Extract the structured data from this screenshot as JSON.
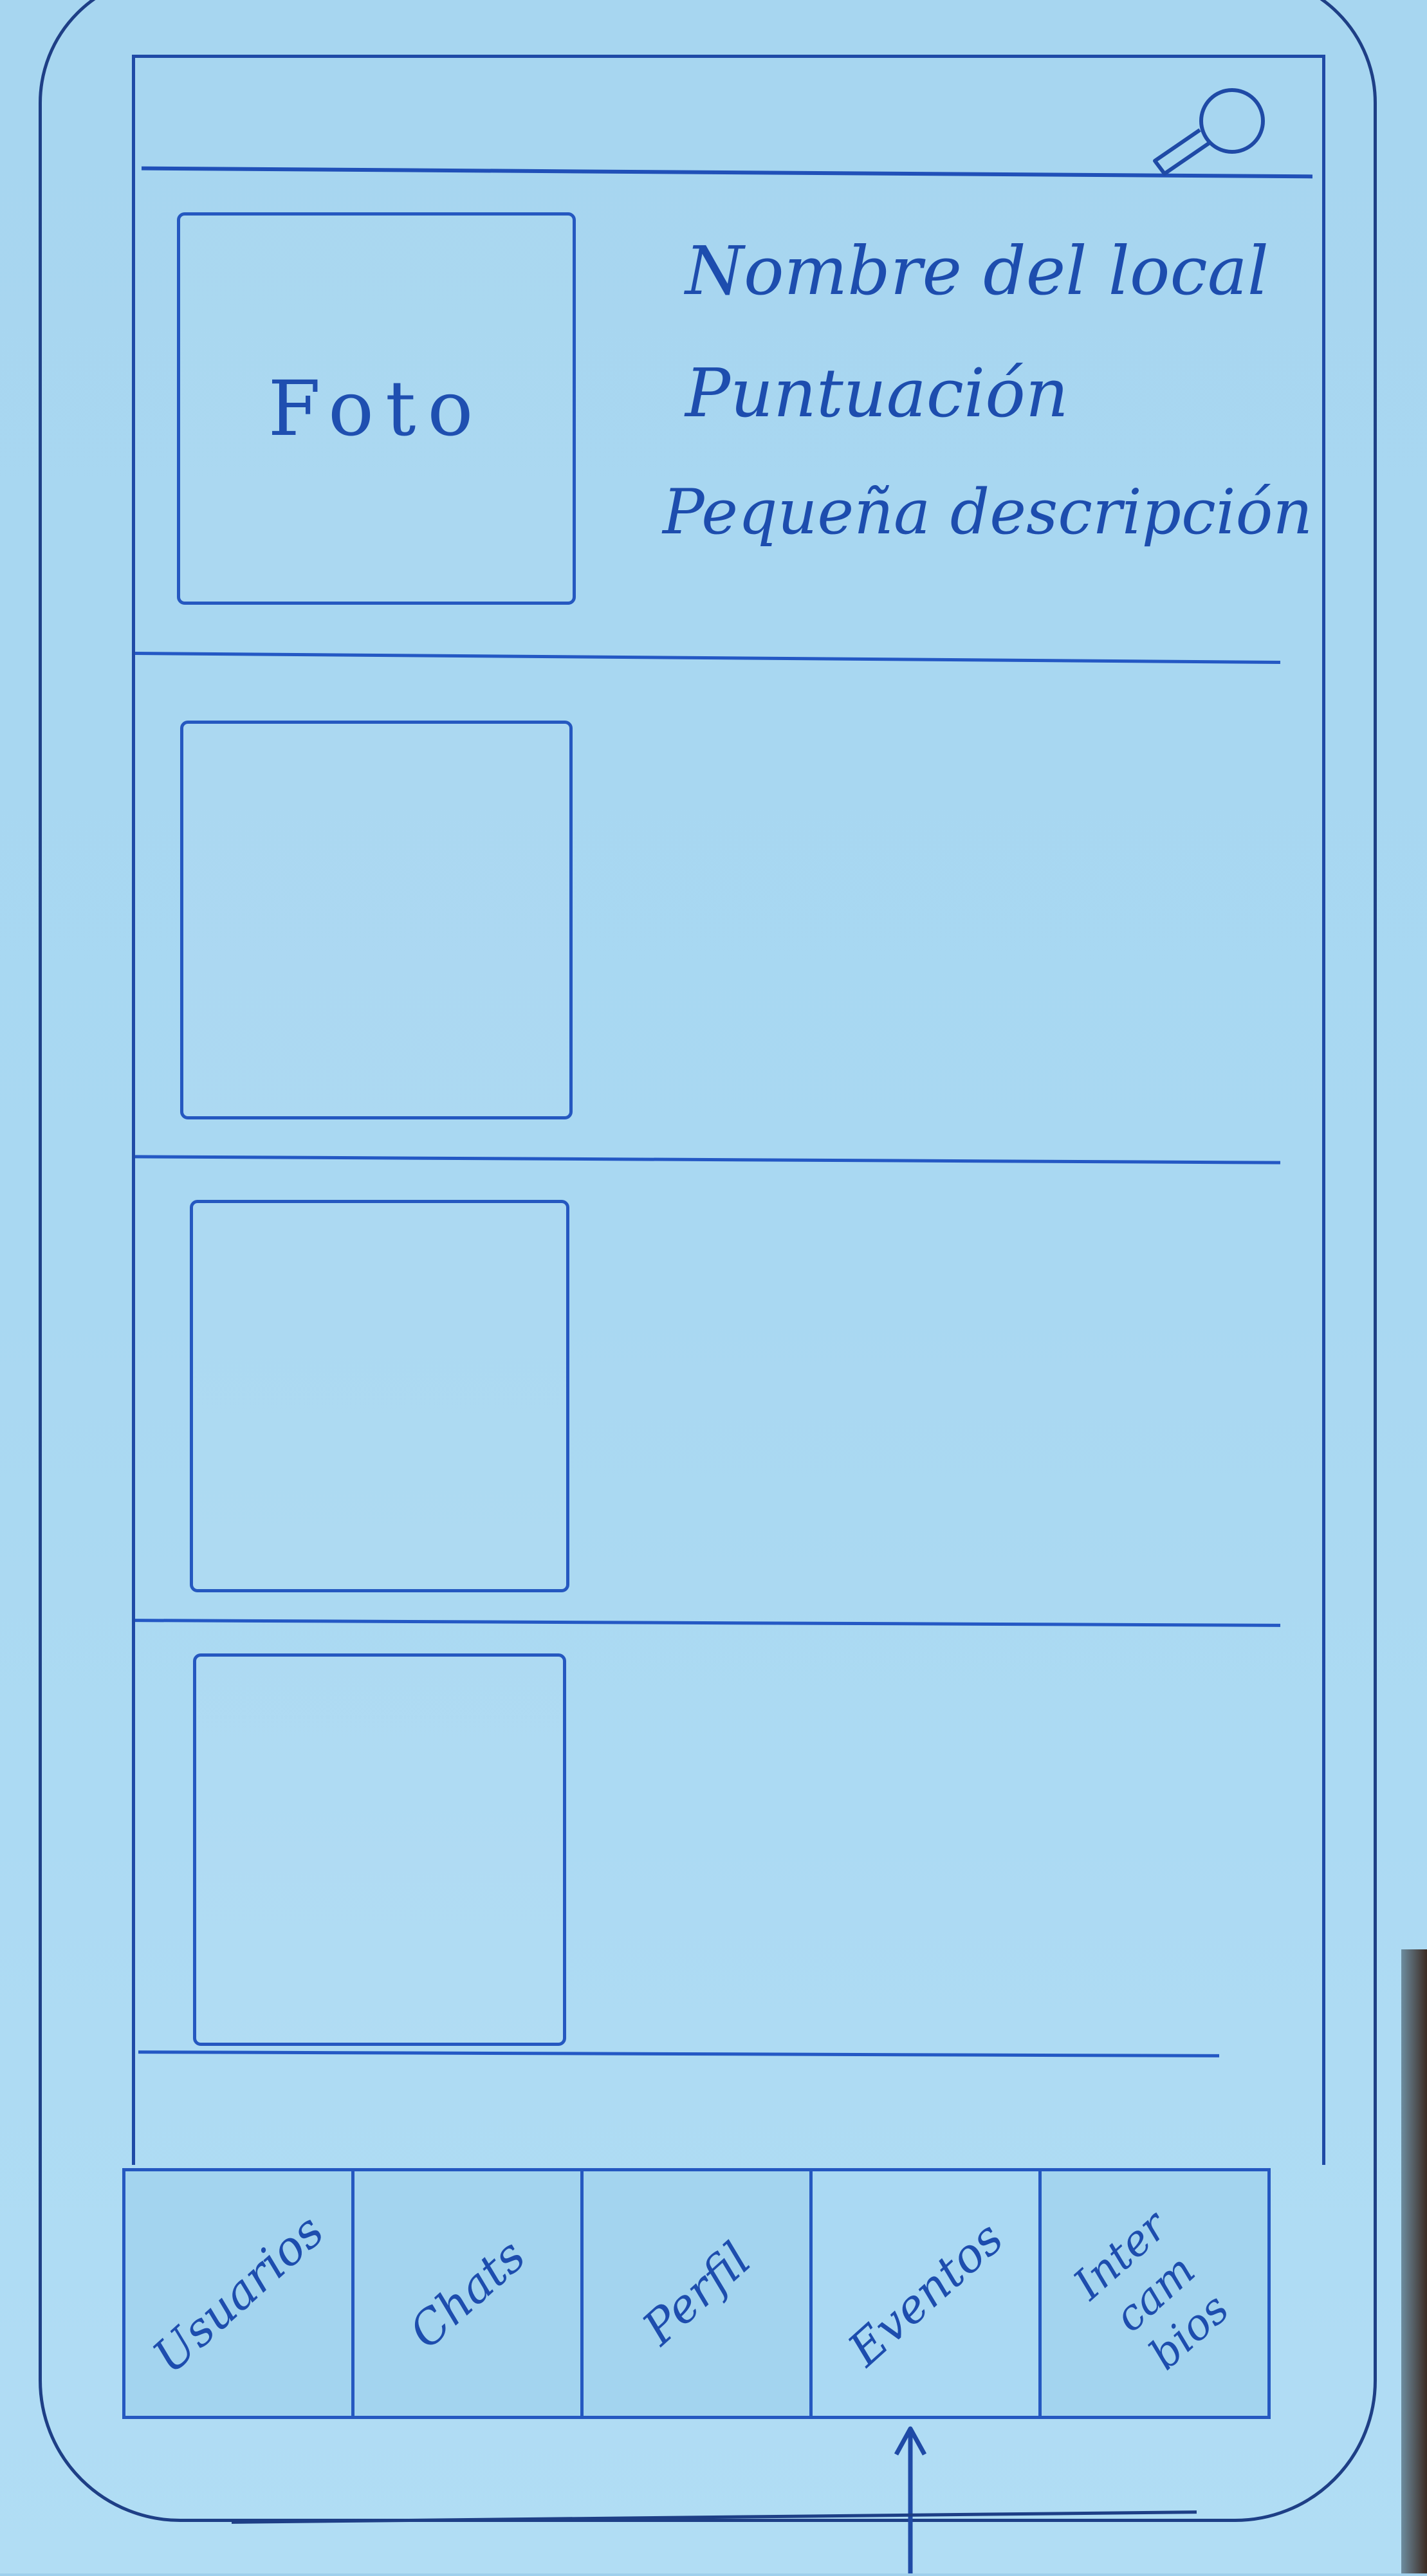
{
  "app": {
    "screen": "lista-locales",
    "colors": {
      "ink": "#1f4fb0",
      "paper": "#a7d6f0"
    }
  },
  "header": {
    "search_icon": "search-icon"
  },
  "list": {
    "items": [
      {
        "photo_label": "Foto",
        "name": "Nombre del local",
        "rating": "Puntuación",
        "description": "Pequeña descripción"
      },
      {
        "photo_label": ""
      },
      {
        "photo_label": ""
      },
      {
        "photo_label": ""
      }
    ]
  },
  "tabbar": {
    "tabs": [
      {
        "label": "Usuarios"
      },
      {
        "label": "Chats"
      },
      {
        "label": "Perfil"
      },
      {
        "label": "Eventos",
        "active": true
      },
      {
        "label": "Intercambios"
      }
    ]
  }
}
